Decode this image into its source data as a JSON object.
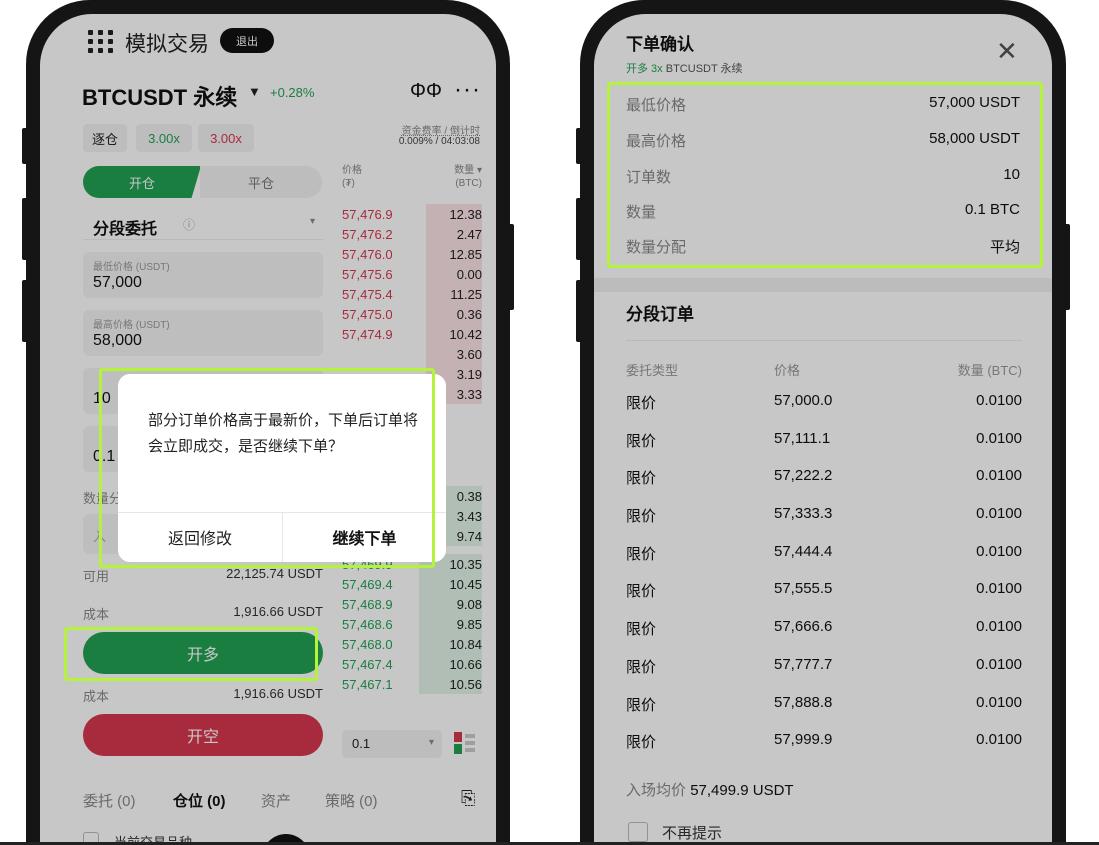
{
  "left": {
    "app_title": "模拟交易",
    "exit_label": "退出",
    "pair": "BTCUSDT 永续",
    "change_pct": "+0.28%",
    "margin_mode": "逐仓",
    "long_leverage": "3.00x",
    "short_leverage": "3.00x",
    "funding_label": "资金费率 / 倒计时",
    "funding_value": "0.009% / 04:03:08",
    "tab_open": "开仓",
    "tab_close": "平仓",
    "ob_price_header": "价格",
    "ob_price_unit": "(₮)",
    "ob_qty_header": "数量",
    "ob_qty_unit": "(BTC)",
    "order_type": "分段委托",
    "low_price_label": "最低价格 (USDT)",
    "low_price_value": "57,000",
    "high_price_label": "最高价格 (USDT)",
    "high_price_value": "58,000",
    "orders_value": "10",
    "qty_value": "0.1",
    "qty_dist_label": "数量分",
    "input_placeholder": "入",
    "available_label": "可用",
    "available_value": "22,125.74 USDT",
    "cost_label": "成本",
    "cost_value": "1,916.66 USDT",
    "long_button": "开多",
    "cost2_label": "成本",
    "cost2_value": "1,916.66 USDT",
    "short_button": "开空",
    "depth_select": "0.1",
    "asks": [
      {
        "p": "57,476.9",
        "q": "12.38"
      },
      {
        "p": "57,476.2",
        "q": "2.47"
      },
      {
        "p": "57,476.0",
        "q": "12.85"
      },
      {
        "p": "57,475.6",
        "q": "0.00"
      },
      {
        "p": "57,475.4",
        "q": "11.25"
      },
      {
        "p": "57,475.0",
        "q": "0.36"
      },
      {
        "p": "57,474.9",
        "q": "10.42"
      }
    ],
    "bids_top": [
      {
        "q": "3.60"
      },
      {
        "q": "3.19"
      },
      {
        "q": "3.33"
      }
    ],
    "bids_mid": [
      {
        "q": "0.38"
      },
      {
        "q": "3.43"
      },
      {
        "q": "9.74"
      }
    ],
    "bids": [
      {
        "p": "57,469.9",
        "q": "10.35"
      },
      {
        "p": "57,469.4",
        "q": "10.45"
      },
      {
        "p": "57,468.9",
        "q": "9.08"
      },
      {
        "p": "57,468.6",
        "q": "9.85"
      },
      {
        "p": "57,468.0",
        "q": "10.84"
      },
      {
        "p": "57,467.4",
        "q": "10.66"
      },
      {
        "p": "57,467.1",
        "q": "10.56"
      }
    ],
    "bottom_tabs": [
      "委托 (0)",
      "仓位 (0)",
      "资产",
      "策略 (0)"
    ],
    "footer_text": "当前交易品种",
    "dialog": {
      "message": "部分订单价格高于最新价，下单后订单将会立即成交，是否继续下单？",
      "back": "返回修改",
      "continue": "继续下单"
    }
  },
  "right": {
    "title": "下单确认",
    "sub_prefix": "开多 3x",
    "sub_pair": "BTCUSDT 永续",
    "summary": [
      {
        "k": "最低价格",
        "v": "57,000 USDT"
      },
      {
        "k": "最高价格",
        "v": "58,000 USDT"
      },
      {
        "k": "订单数",
        "v": "10"
      },
      {
        "k": "数量",
        "v": "0.1 BTC"
      },
      {
        "k": "数量分配",
        "v": "平均"
      }
    ],
    "section_title": "分段订单",
    "headers": [
      "委托类型",
      "价格",
      "数量 (BTC)"
    ],
    "rows": [
      {
        "t": "限价",
        "p": "57,000.0",
        "q": "0.0100"
      },
      {
        "t": "限价",
        "p": "57,111.1",
        "q": "0.0100"
      },
      {
        "t": "限价",
        "p": "57,222.2",
        "q": "0.0100"
      },
      {
        "t": "限价",
        "p": "57,333.3",
        "q": "0.0100"
      },
      {
        "t": "限价",
        "p": "57,444.4",
        "q": "0.0100"
      },
      {
        "t": "限价",
        "p": "57,555.5",
        "q": "0.0100"
      },
      {
        "t": "限价",
        "p": "57,666.6",
        "q": "0.0100"
      },
      {
        "t": "限价",
        "p": "57,777.7",
        "q": "0.0100"
      },
      {
        "t": "限价",
        "p": "57,888.8",
        "q": "0.0100"
      },
      {
        "t": "限价",
        "p": "57,999.9",
        "q": "0.0100"
      }
    ],
    "avg_label": "入场均价",
    "avg_value": "57,499.9 USDT",
    "dont_show": "不再提示"
  },
  "colors": {
    "green": "#23a254",
    "red": "#d8364f",
    "highlight": "#b5f23c"
  }
}
